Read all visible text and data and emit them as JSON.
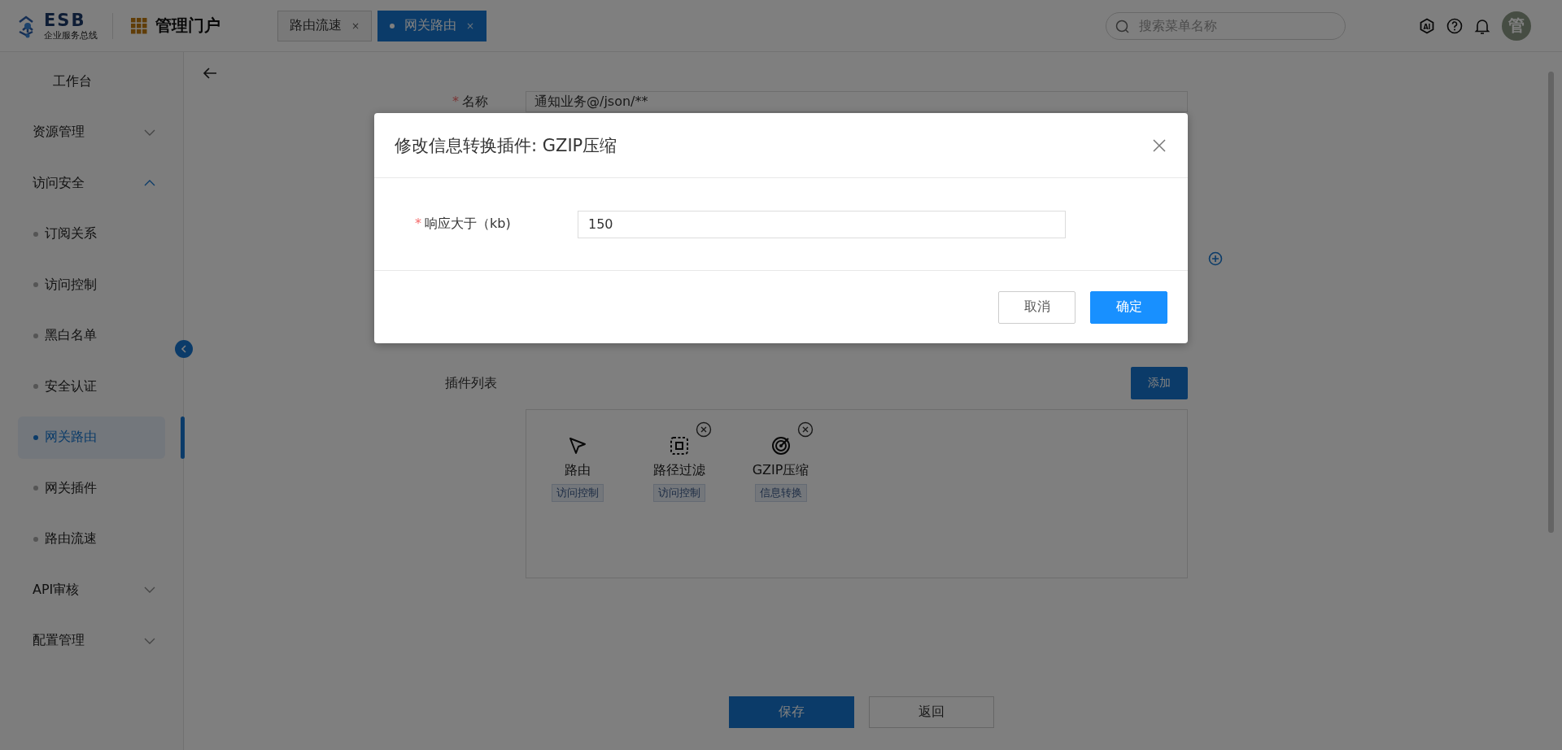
{
  "header": {
    "logo_title": "ESB",
    "logo_subtitle": "企业服务总线",
    "portal_title": "管理门户",
    "tabs": [
      {
        "label": "路由流速",
        "selected": false,
        "close": "×"
      },
      {
        "label": "网关路由",
        "selected": true,
        "close": "×"
      }
    ],
    "search": {
      "placeholder": "搜索菜单名称"
    },
    "ai_label": "AI",
    "avatar_text": "管"
  },
  "sidebar": {
    "items": [
      {
        "label": "工作台",
        "kind": "link"
      },
      {
        "label": "资源管理",
        "kind": "group",
        "expanded": false
      },
      {
        "label": "访问安全",
        "kind": "group",
        "expanded": true,
        "children": [
          {
            "label": "订阅关系",
            "selected": false
          },
          {
            "label": "访问控制",
            "selected": false
          },
          {
            "label": "黑白名单",
            "selected": false
          },
          {
            "label": "安全认证",
            "selected": false
          },
          {
            "label": "网关路由",
            "selected": true
          },
          {
            "label": "网关插件",
            "selected": false
          },
          {
            "label": "路由流速",
            "selected": false
          }
        ]
      },
      {
        "label": "API审核",
        "kind": "group",
        "expanded": false
      },
      {
        "label": "配置管理",
        "kind": "group",
        "expanded": false
      }
    ]
  },
  "form": {
    "name_label": "名称",
    "name_required_mark": "*",
    "name_value": "通知业务@/json/**",
    "plugins_label": "插件列表",
    "add_button": "添加",
    "plugins": [
      {
        "name": "路由",
        "tag": "访问控制",
        "kind": "route",
        "removable": false
      },
      {
        "name": "路径过滤",
        "tag": "访问控制",
        "kind": "filter",
        "removable": true
      },
      {
        "name": "GZIP压缩",
        "tag": "信息转换",
        "kind": "compress",
        "removable": true
      }
    ]
  },
  "footer_buttons": [
    {
      "label": "保存",
      "kind": "primary"
    },
    {
      "label": "返回",
      "kind": "default"
    }
  ],
  "dialog": {
    "title": "修改信息转换插件: GZIP压缩",
    "fields": [
      {
        "label": "响应大于（kb)",
        "required_mark": "*",
        "value": "150"
      }
    ],
    "buttons": [
      {
        "label": "取消",
        "kind": "default"
      },
      {
        "label": "确定",
        "kind": "primary"
      }
    ]
  }
}
